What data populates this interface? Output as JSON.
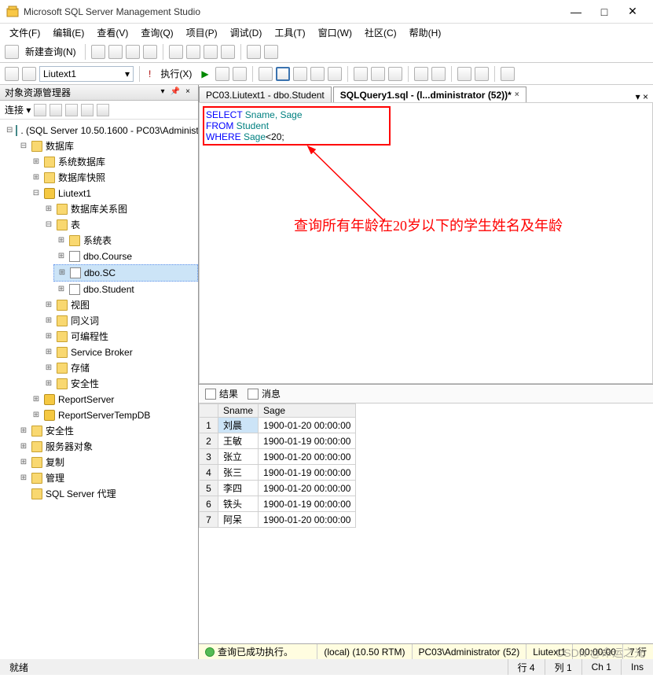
{
  "window": {
    "title": "Microsoft SQL Server Management Studio",
    "min": "—",
    "max": "□",
    "close": "✕"
  },
  "menu": [
    "文件(F)",
    "编辑(E)",
    "查看(V)",
    "查询(Q)",
    "项目(P)",
    "调试(D)",
    "工具(T)",
    "窗口(W)",
    "社区(C)",
    "帮助(H)"
  ],
  "toolbar1": {
    "newQuery": "新建查询(N)"
  },
  "toolbar2": {
    "combo": "Liutext1",
    "execute": "执行(X)"
  },
  "objectExplorer": {
    "paneTitle": "对象资源管理器",
    "connectLabel": "连接 ▾",
    "rootServer": ". (SQL Server 10.50.1600 - PC03\\Administ",
    "nodes": {
      "databases": "数据库",
      "sysdb": "系统数据库",
      "dbsnap": "数据库快照",
      "liutext": "Liutext1",
      "dbdiagram": "数据库关系图",
      "tables": "表",
      "systables": "系统表",
      "course": "dbo.Course",
      "sc": "dbo.SC",
      "student": "dbo.Student",
      "views": "视图",
      "synonyms": "同义词",
      "programmability": "可编程性",
      "servicebroker": "Service Broker",
      "storage": "存储",
      "security": "安全性",
      "reportsvr": "ReportServer",
      "reportsvrtmp": "ReportServerTempDB",
      "dbsecurity": "安全性",
      "serverobj": "服务器对象",
      "replication": "复制",
      "management": "管理",
      "agent": "SQL Server 代理"
    }
  },
  "tabs": {
    "inactive": "PC03.Liutext1 - dbo.Student",
    "active": "SQLQuery1.sql - (l...dministrator (52))*"
  },
  "sql": [
    [
      {
        "t": "SELECT",
        "c": "kw"
      },
      {
        "t": "  Sname, Sage",
        "c": "ident"
      }
    ],
    [
      {
        "t": "FROM",
        "c": "kw"
      },
      {
        "t": "  Student",
        "c": "ident"
      }
    ],
    [
      {
        "t": "WHERE",
        "c": "kw"
      },
      {
        "t": "  Sage",
        "c": "ident"
      },
      {
        "t": "<20;",
        "c": ""
      }
    ]
  ],
  "annotation": "查询所有年龄在20岁以下的学生姓名及年龄",
  "resultsTabs": {
    "results": "结果",
    "messages": "消息"
  },
  "grid": {
    "headers": [
      "",
      "Sname",
      "Sage"
    ],
    "rows": [
      [
        "1",
        "刘晨",
        "1900-01-20 00:00:00"
      ],
      [
        "2",
        "王敏",
        "1900-01-19 00:00:00"
      ],
      [
        "3",
        "张立",
        "1900-01-20 00:00:00"
      ],
      [
        "4",
        "张三",
        "1900-01-19 00:00:00"
      ],
      [
        "5",
        "李四",
        "1900-01-20 00:00:00"
      ],
      [
        "6",
        "铁头",
        "1900-01-19 00:00:00"
      ],
      [
        "7",
        "阿呆",
        "1900-01-20 00:00:00"
      ]
    ]
  },
  "queryStatus": {
    "msg": "查询已成功执行。",
    "server": "(local) (10.50 RTM)",
    "user": "PC03\\Administrator (52)",
    "db": "Liutext1",
    "time": "00:00:00",
    "rows": "7 行"
  },
  "statusBar": {
    "ready": "就绪",
    "line": "行 4",
    "col": "列 1",
    "ch": "Ch 1",
    "ins": "Ins"
  },
  "watermark": "CSDN @命运之光"
}
